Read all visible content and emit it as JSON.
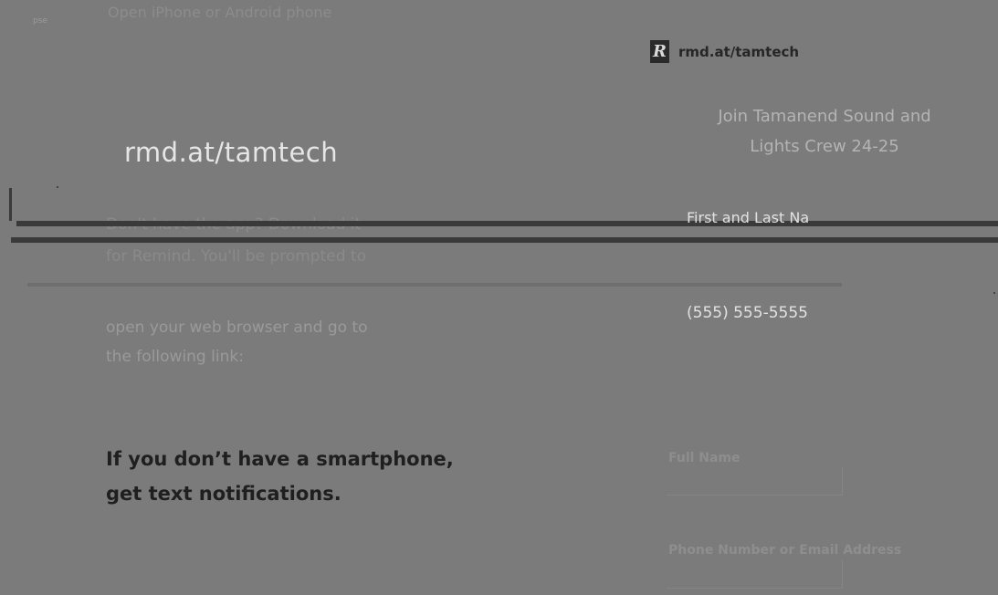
{
  "left": {
    "top_fragment": "Open iPhone or Android phone",
    "corner_mark": "pse",
    "url_heading": "rmd.at/tamtech",
    "faded_line_1": "Don't have the app? Download it",
    "faded_line_2": "for Remind. You'll be prompted to",
    "body_line_1": "open your web browser and go to",
    "body_line_2": "the following link:",
    "sms_line_1": "If you don’t have a smartphone,",
    "sms_line_2": "get text notifications."
  },
  "right": {
    "logo_letter": "R",
    "brand_url": "rmd.at/tamtech",
    "class_title_line_1": "Join Tamanend Sound and",
    "class_title_line_2": "Lights Crew 24-25",
    "first_last_placeholder": "First and Last Na",
    "phone_placeholder": "(555) 555-5555",
    "full_name_label": "Full Name",
    "contact_label": "Phone Number or Email Address"
  },
  "colors": {
    "background": "#7b7b7b",
    "heading_dark": "#1f1f1f",
    "band_dark": "#3a3a3a"
  },
  "icons": {
    "logo": "remind-logo-icon"
  }
}
